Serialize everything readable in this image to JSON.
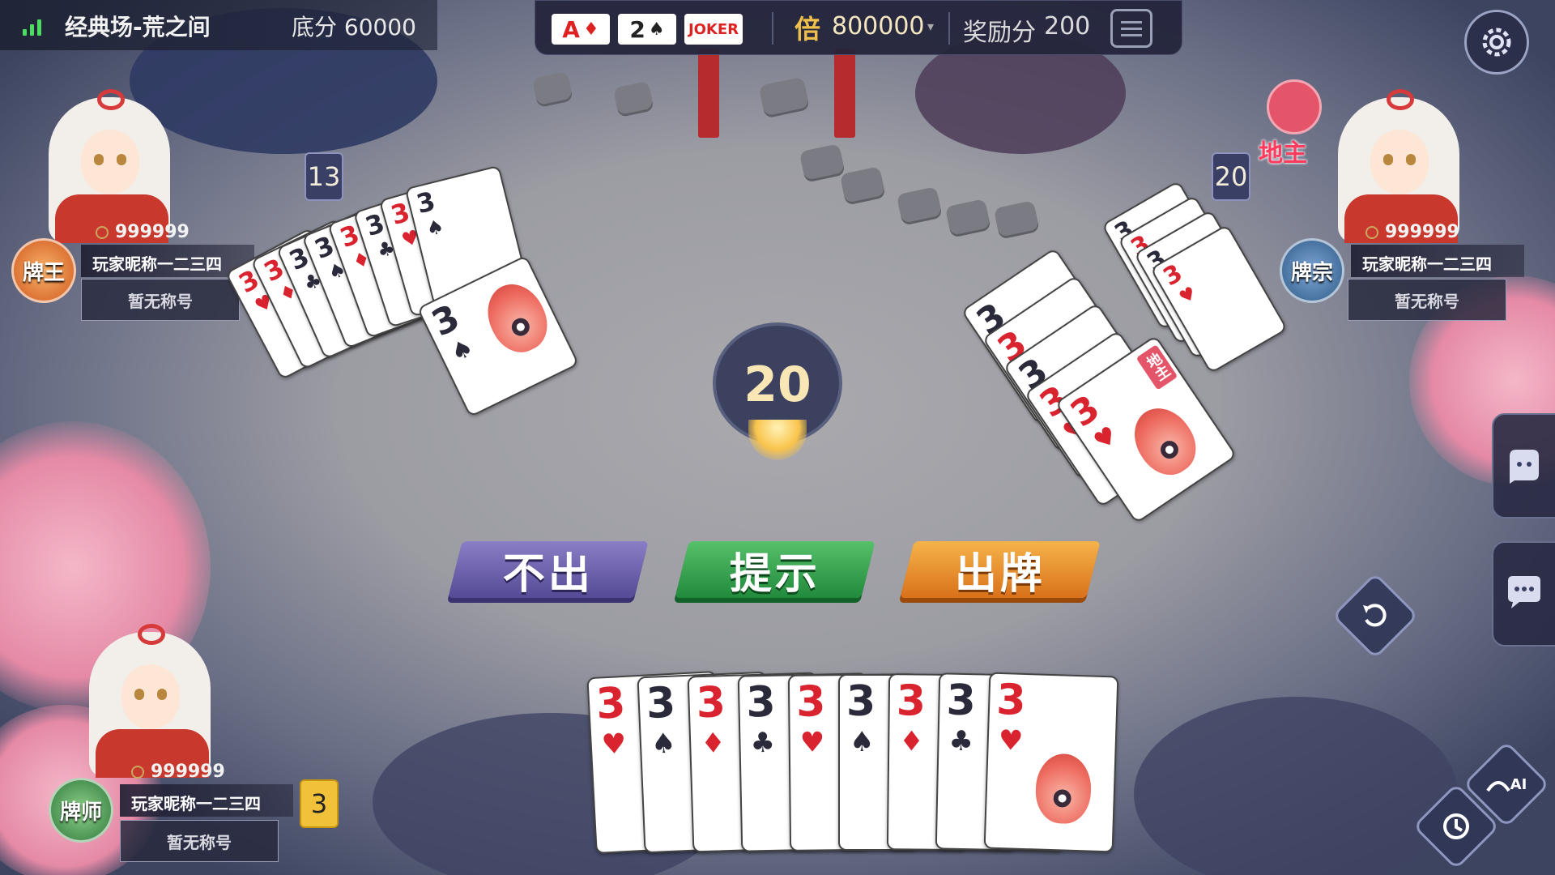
{
  "top_bar": {
    "room_name": "经典场-荒之间",
    "base_score": "底分 60000",
    "hole_cards": [
      {
        "rank": "A",
        "suit": "♦",
        "color": "#d9232e"
      },
      {
        "rank": "2",
        "suit": "♠",
        "color": "#2a2a3a"
      },
      {
        "rank": "JOKER",
        "suit": "",
        "color": "#d9232e"
      }
    ],
    "multiplier_label": "倍",
    "multiplier_value": "800000",
    "reward_label": "奖励分",
    "reward_value": "200"
  },
  "players": {
    "left": {
      "score": "999999",
      "nickname": "玩家昵称一二三四",
      "title": "暂无称号",
      "rank_badge": "牌王",
      "cards_left": "13"
    },
    "right": {
      "score": "999999",
      "nickname": "玩家昵称一二三四",
      "title": "暂无称号",
      "rank_badge": "牌宗",
      "cards_left": "20",
      "role": "地主"
    },
    "bottom": {
      "score": "999999",
      "nickname": "玩家昵称一二三四",
      "title": "暂无称号",
      "rank_badge": "牌师",
      "cards_left": "3"
    }
  },
  "timer": {
    "seconds": "20"
  },
  "actions": {
    "pass": "不出",
    "hint": "提示",
    "play": "出牌"
  },
  "hand": [
    {
      "rank": "3",
      "suit": "♥",
      "color": "red"
    },
    {
      "rank": "3",
      "suit": "♠",
      "color": "black"
    },
    {
      "rank": "3",
      "suit": "♦",
      "color": "red"
    },
    {
      "rank": "3",
      "suit": "♣",
      "color": "black"
    },
    {
      "rank": "3",
      "suit": "♥",
      "color": "red"
    },
    {
      "rank": "3",
      "suit": "♠",
      "color": "black"
    },
    {
      "rank": "3",
      "suit": "♦",
      "color": "red"
    },
    {
      "rank": "3",
      "suit": "♣",
      "color": "black"
    },
    {
      "rank": "3",
      "suit": "♥",
      "color": "red"
    }
  ],
  "left_played": [
    {
      "rank": "3",
      "suit": "♥",
      "color": "red"
    },
    {
      "rank": "3",
      "suit": "♦",
      "color": "red"
    },
    {
      "rank": "3",
      "suit": "♣",
      "color": "black"
    },
    {
      "rank": "3",
      "suit": "♠",
      "color": "black"
    },
    {
      "rank": "3",
      "suit": "♦",
      "color": "red"
    },
    {
      "rank": "3",
      "suit": "♣",
      "color": "black"
    },
    {
      "rank": "3",
      "suit": "♥",
      "color": "red"
    },
    {
      "rank": "3",
      "suit": "♠",
      "color": "black"
    }
  ],
  "right_played": [
    {
      "rank": "3",
      "suit": "♠",
      "color": "black"
    },
    {
      "rank": "3",
      "suit": "♦",
      "color": "red"
    },
    {
      "rank": "3",
      "suit": "♣",
      "color": "black"
    },
    {
      "rank": "3",
      "suit": "♥",
      "color": "red"
    }
  ],
  "right_played_label": "地主",
  "side_controls": {
    "ai_label": "AI"
  },
  "icons": [
    "signal-icon",
    "record-icon",
    "settings-icon",
    "emoji-icon",
    "chat-icon",
    "undo-icon",
    "ai-icon",
    "history-icon",
    "coin-icon"
  ]
}
